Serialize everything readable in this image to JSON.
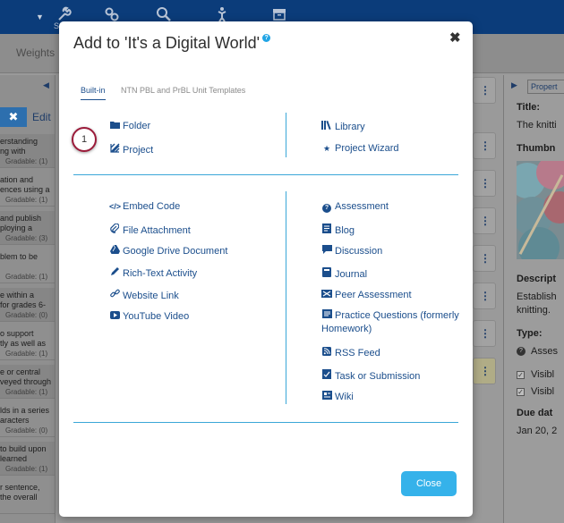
{
  "background": {
    "topbar_label_fragment": "S",
    "subbar_weights": "Weights",
    "left_panel": {
      "edit_label": "Edit",
      "rows": [
        {
          "line1": "erstanding",
          "line2": "ng with",
          "gradable": "Gradable: (1)"
        },
        {
          "line1": "ation and",
          "line2": "ences using a",
          "gradable": "Gradable: (1)"
        },
        {
          "line1": "and publish",
          "line2": "ploying a",
          "gradable": "Gradable: (3)"
        },
        {
          "line1": "blem to be",
          "line2": "",
          "gradable": "Gradable: (1)"
        },
        {
          "line1": "e within a",
          "line2": "for grades 6-",
          "gradable": "Gradable: (0)"
        },
        {
          "line1": "o support",
          "line2": "tly as well as",
          "gradable": "Gradable: (1)"
        },
        {
          "line1": "e or central",
          "line2": "veyed through",
          "gradable": "Gradable: (1)"
        },
        {
          "line1": "lds in a series",
          "line2": "aracters",
          "gradable": "Gradable: (0)"
        },
        {
          "line1": "to build upon",
          "line2": "learned",
          "gradable": "Gradable: (1)"
        },
        {
          "line1": "r sentence,",
          "line2": "the overall",
          "gradable": ""
        }
      ]
    },
    "right_panel": {
      "tab_label": "Propert",
      "title_label": "Title:",
      "title_value": "The knitti",
      "thumbnail_label": "Thumbn",
      "description_label": "Descript",
      "description_line1": "Establish",
      "description_line2": "knitting.",
      "type_label": "Type:",
      "type_value": "Asses",
      "visible1": "Visibl",
      "visible2": "Visibl",
      "due_label": "Due dat",
      "due_value": "Jan 20, 2"
    }
  },
  "modal": {
    "title": "Add to 'It's a Digital World'",
    "close_x": "✖",
    "tabs": [
      {
        "label": "Built-in"
      },
      {
        "label": "NTN PBL and PrBL Unit Templates"
      }
    ],
    "section1_left": [
      {
        "label": "Folder",
        "icon": "folder-icon"
      },
      {
        "label": "Project",
        "icon": "project-icon"
      }
    ],
    "section1_right": [
      {
        "label": "Library",
        "icon": "library-icon"
      },
      {
        "label": "Project Wizard",
        "icon": "star-icon"
      }
    ],
    "section2_left": [
      {
        "label": "Embed Code",
        "icon": "code-icon"
      },
      {
        "label": "File Attachment",
        "icon": "paperclip-icon"
      },
      {
        "label": "Google Drive Document",
        "icon": "google-drive-icon"
      },
      {
        "label": "Rich-Text Activity",
        "icon": "pencil-icon"
      },
      {
        "label": "Website Link",
        "icon": "link-icon"
      },
      {
        "label": "YouTube Video",
        "icon": "youtube-icon"
      }
    ],
    "section2_right": [
      {
        "label": "Assessment",
        "icon": "question-icon"
      },
      {
        "label": "Blog",
        "icon": "blog-icon"
      },
      {
        "label": "Discussion",
        "icon": "discussion-icon"
      },
      {
        "label": "Journal",
        "icon": "journal-icon"
      },
      {
        "label": "Peer Assessment",
        "icon": "peer-assessment-icon"
      },
      {
        "label": "Practice Questions (formerly Homework)",
        "icon": "practice-questions-icon"
      },
      {
        "label": "RSS Feed",
        "icon": "rss-icon"
      },
      {
        "label": "Task or Submission",
        "icon": "task-icon"
      },
      {
        "label": "Wiki",
        "icon": "wiki-icon"
      }
    ],
    "callout_number": "1",
    "close_button": "Close"
  },
  "colors": {
    "accent": "#35b2ea",
    "link": "#1b4e8c",
    "divider": "#3aa7d8",
    "callout_border": "#9b1b3a",
    "topbar": "#0b3c7a"
  }
}
